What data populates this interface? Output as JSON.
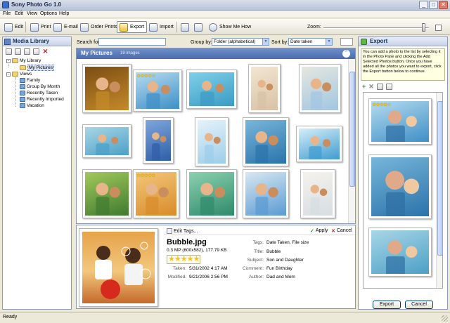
{
  "window": {
    "title": "Sony Photo Go 1.0",
    "minimize_glyph": "_",
    "maximize_glyph": "□",
    "close_glyph": "✕"
  },
  "menu": [
    "File",
    "Edit",
    "View",
    "Options",
    "Help"
  ],
  "toolbar": {
    "edit": "Edit",
    "print": "Print",
    "email": "E-mail",
    "order_prints": "Order Prints",
    "export": "Export",
    "import": "Import",
    "show_me_how": "Show Me How",
    "zoom_label": "Zoom:",
    "zoom_level": 0.95
  },
  "media_library": {
    "title": "Media Library",
    "delete_glyph": "✕",
    "tree": [
      {
        "label": "My Library",
        "icon": "folder-icon",
        "expander": "−"
      },
      {
        "label": "My Pictures",
        "icon": "folder-icon",
        "selected": true
      },
      {
        "label": "Views",
        "icon": "folder-icon",
        "expander": "−"
      },
      {
        "label": "Family",
        "icon": "view-icon"
      },
      {
        "label": "Group By Month",
        "icon": "view-icon"
      },
      {
        "label": "Recently Taken",
        "icon": "view-icon"
      },
      {
        "label": "Recently Imported",
        "icon": "view-icon"
      },
      {
        "label": "Vacation",
        "icon": "view-icon"
      }
    ]
  },
  "filter": {
    "search_label": "Search for:",
    "search_value": "",
    "group_by_label": "Group by:",
    "group_by_value": "Folder (alphabetical)",
    "sort_by_label": "Sort by:",
    "sort_by_value": "Date taken"
  },
  "grid": {
    "title": "My Pictures",
    "count": "19 images",
    "collapse_glyph": "⌃",
    "photos": [
      {
        "subject": "bicycle against yellow wall",
        "bg1": "#c58a2a",
        "bg2": "#7a4d14",
        "stars": ""
      },
      {
        "subject": "hugging couple, seaside",
        "bg1": "#3f8fc7",
        "bg2": "#b5dcef",
        "stars": "★★★★☆"
      },
      {
        "subject": "two children smiling",
        "bg1": "#3c9bc4",
        "bg2": "#7fd0e8",
        "stars": ""
      },
      {
        "subject": "kids hugging",
        "bg1": "#d8c2a4",
        "bg2": "#f2e5d2",
        "stars": ""
      },
      {
        "subject": "kids walking on beach",
        "bg1": "#a2c6e2",
        "bg2": "#e4e7df",
        "stars": ""
      },
      {
        "subject": "mother and daughter",
        "bg1": "#4ca0c7",
        "bg2": "#a8d6e6",
        "stars": ""
      },
      {
        "subject": "yellow kite",
        "bg1": "#2f5ea8",
        "bg2": "#7ea6dc",
        "stars": ""
      },
      {
        "subject": "father carrying child",
        "bg1": "#9ccdea",
        "bg2": "#e5f2fa",
        "stars": ""
      },
      {
        "subject": "father and daughter",
        "bg1": "#2a73aa",
        "bg2": "#78b6da",
        "stars": ""
      },
      {
        "subject": "girl close-up",
        "bg1": "#3f9bd0",
        "bg2": "#d6eef8",
        "stars": ""
      },
      {
        "subject": "family outdoors",
        "bg1": "#3f7a2f",
        "bg2": "#a3c95c",
        "stars": ""
      },
      {
        "subject": "kids with bubbles",
        "bg1": "#d98b2a",
        "bg2": "#f2c77a",
        "stars": "★★★★★"
      },
      {
        "subject": "group of children",
        "bg1": "#2f8a6b",
        "bg2": "#8ad1b0",
        "stars": ""
      },
      {
        "subject": "two beach chairs",
        "bg1": "#5a9ad3",
        "bg2": "#d8e8f2",
        "stars": ""
      },
      {
        "subject": "girl on beach",
        "bg1": "#d7dde2",
        "bg2": "#f5f2ec",
        "stars": ""
      }
    ]
  },
  "details": {
    "edit_tags": "Edit Tags...",
    "apply": "Apply",
    "cancel": "Cancel",
    "file_name": "Bubble.jpg",
    "file_info": "0.3 MP (600x582), 177.79 KB",
    "stars": "★★★★★",
    "taken_label": "Taken:",
    "taken_value": "5/31/2002 4:17 AM",
    "modified_label": "Modified:",
    "modified_value": "9/21/2006 2:56 PM",
    "tags_label": "Tags:",
    "tags_value": "Date Taken, File size",
    "title_label": "Title:",
    "title_value": "Bubble",
    "subject_label": "Subject:",
    "subject_value": "Son and Daughter",
    "comment_label": "Comment:",
    "comment_value": "Fun Birthday",
    "author_label": "Author:",
    "author_value": "Dad and Mom"
  },
  "export_pane": {
    "title": "Export",
    "help": "You can add a photo to the list by selecting it in the Photo Pane and clicking the Add Selected Photos button. Once you have added all the photos you want to export, click the Export button below to continue.",
    "add_glyph": "+",
    "remove_glyph": "✕",
    "photos": [
      {
        "subject": "hugging couple, seaside",
        "bg1": "#3f8fc7",
        "bg2": "#b5dcef",
        "stars": "★★★★☆"
      },
      {
        "subject": "father and daughter",
        "bg1": "#2a73aa",
        "bg2": "#78b6da",
        "stars": ""
      },
      {
        "subject": "mother and daughter",
        "bg1": "#4ca0c7",
        "bg2": "#a8d6e6",
        "stars": ""
      }
    ],
    "export_btn": "Export",
    "cancel_btn": "Cancel"
  },
  "status": {
    "text": "Ready"
  }
}
